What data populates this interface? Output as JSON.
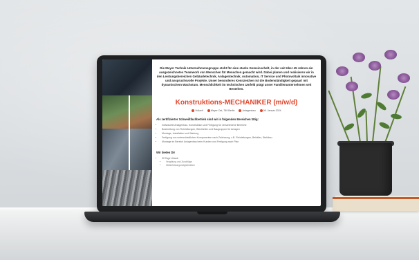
{
  "web_page": {
    "intro_text": "Die Meyer Technik Unternehmensgruppe steht für eine starke Gemeinschaft, in der seit über 45 Jahren ein ausgezeichnetes Teamwork von Menschen für Menschen gemacht wird. Dabei planen und realisieren wir in den Leistungsbereichen Gebäudetechnik, Anlagentechnik, Automation, IT Service und Photovoltaik innovative und anspruchsvolle Projekte. Unser besonderes Kennzeichen ist die Bodenständigkeit gepaart mit dynamischem Wachstum. Menschlichkeit im technischen Umfeld prägt unser Familienunternehmen seit Bestehen.",
    "job_title": "Konstruktions-MECHANIKER (m/w/d)",
    "meta": {
      "type": "Vollzeit",
      "location": "Meyer Ost, 789 Berlin",
      "department": "Anlagenbau",
      "date": "06. Januar 2024"
    },
    "section_heading": "Als zertifizierter Schweißfachbetrieb sind wir in folgenden Bereichen tätig:",
    "bullets": [
      "Individuelle Anlagenbau, Konstruktion und Fertigung für verschiedene Bereiche",
      "Bearbeitung von Rohrleitungen, Blechteilen und Baugruppen für Anlagen",
      "Montage, Installation und Wartung",
      "Fertigung von unterschiedlichen Komponenten nach Zeichnung, z.B. Rohrleitungen, Behälter, Stahlbau",
      "Montage im Bereich Anlagenbau beim Kunden und Fertigung nach Plan"
    ],
    "offer_heading": "Wir bieten Dir",
    "offer_items": [
      "30 Tage Urlaub",
      "Vergütung und Zuschläge",
      "Weiterbildungsmöglichkeiten"
    ]
  }
}
